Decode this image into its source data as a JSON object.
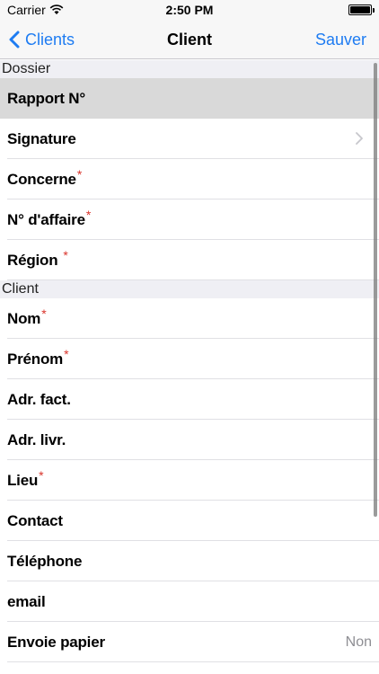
{
  "status": {
    "carrier": "Carrier",
    "time": "2:50 PM",
    "battery_level": 1.0
  },
  "nav": {
    "back": "Clients",
    "title": "Client",
    "save": "Sauver"
  },
  "sections": [
    {
      "title": "Dossier",
      "rows": [
        {
          "label": "Rapport N°",
          "required": false
        },
        {
          "label": "Signature",
          "required": false
        },
        {
          "label": "Concerne",
          "required": true
        },
        {
          "label": "N° d'affaire",
          "required": true
        },
        {
          "label": "Région",
          "required": true
        }
      ]
    },
    {
      "title": "Client",
      "rows": [
        {
          "label": "Nom",
          "required": true
        },
        {
          "label": "Prénom",
          "required": true
        },
        {
          "label": "Adr. fact.",
          "required": false
        },
        {
          "label": "Adr. livr.",
          "required": false
        },
        {
          "label": "Lieu",
          "required": true
        },
        {
          "label": "Contact",
          "required": false
        },
        {
          "label": "Téléphone",
          "required": false
        },
        {
          "label": "email",
          "required": false
        },
        {
          "label": "Envoie papier",
          "required": false,
          "value": "Non"
        }
      ]
    }
  ],
  "required_marker": "*"
}
